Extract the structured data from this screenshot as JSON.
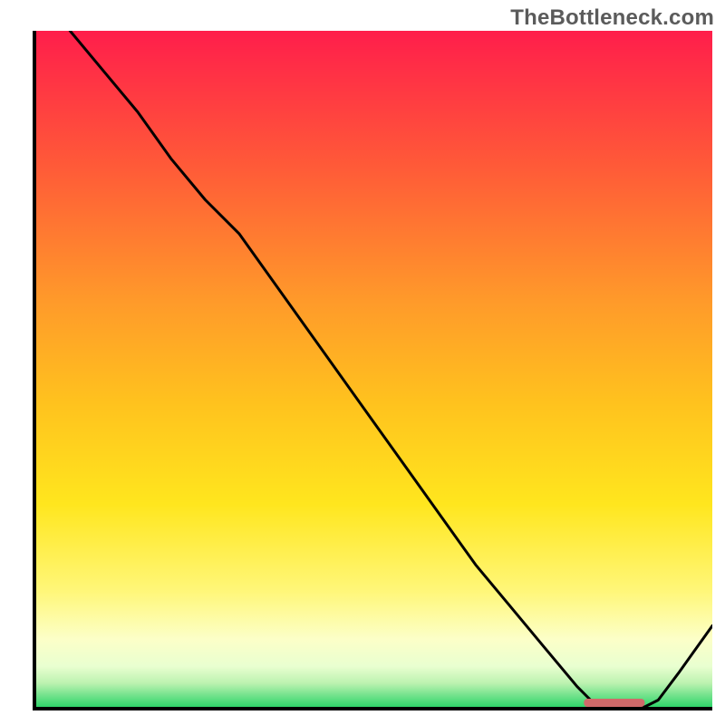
{
  "watermark": "TheBottleneck.com",
  "colors": {
    "gradient_top": "#ff1e4b",
    "gradient_mid_upper": "#ff8a2a",
    "gradient_mid": "#ffd21e",
    "gradient_lower": "#fff7a8",
    "gradient_pale": "#f6ffe0",
    "gradient_bottom": "#2fd56a",
    "axis": "#000000",
    "curve": "#000000",
    "marker": "#d06a6a"
  },
  "chart_data": {
    "type": "line",
    "title": "",
    "xlabel": "",
    "ylabel": "",
    "xlim": [
      0,
      100
    ],
    "ylim": [
      0,
      100
    ],
    "series": [
      {
        "name": "bottleneck-curve",
        "x": [
          5,
          10,
          15,
          20,
          25,
          30,
          35,
          40,
          45,
          50,
          55,
          60,
          65,
          70,
          75,
          80,
          82,
          84,
          86,
          88,
          90,
          92,
          95,
          100
        ],
        "y": [
          100,
          94,
          88,
          81,
          75,
          70,
          63,
          56,
          49,
          42,
          35,
          28,
          21,
          15,
          9,
          3,
          1,
          0,
          0,
          0,
          0,
          1,
          5,
          12
        ]
      }
    ],
    "optimal_marker": {
      "x_start": 81,
      "x_end": 90,
      "y": 0
    },
    "grid": false,
    "legend": false
  }
}
